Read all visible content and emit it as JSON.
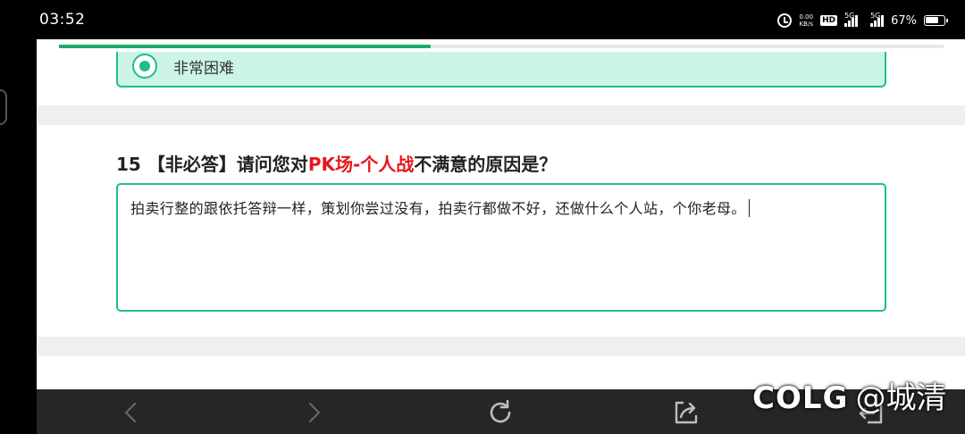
{
  "status_bar": {
    "time": "03:52",
    "net_speed_value": "0.00",
    "net_speed_unit": "KB/s",
    "hd_label": "HD",
    "sim1_label": "5G",
    "sim2_label": "5G",
    "battery_percent": "67%"
  },
  "survey": {
    "progress": 0.42,
    "prev_option": {
      "label": "非常困难",
      "selected": true
    },
    "question15": {
      "number": "15",
      "tag": "【非必答】",
      "text_before": "请问您对",
      "highlight": "PK场-个人战",
      "text_after": "不满意的原因是？",
      "answer": "拍卖行整的跟依托答辩一样，策划你尝过没有，拍卖行都做不好，还做什么个人站，个你老母。"
    }
  },
  "watermark": {
    "brand": "COLG",
    "handle": "@城清"
  },
  "colors": {
    "accent": "#1fbf84",
    "option_bg": "#cdf5e6",
    "highlight": "#e8161c"
  }
}
